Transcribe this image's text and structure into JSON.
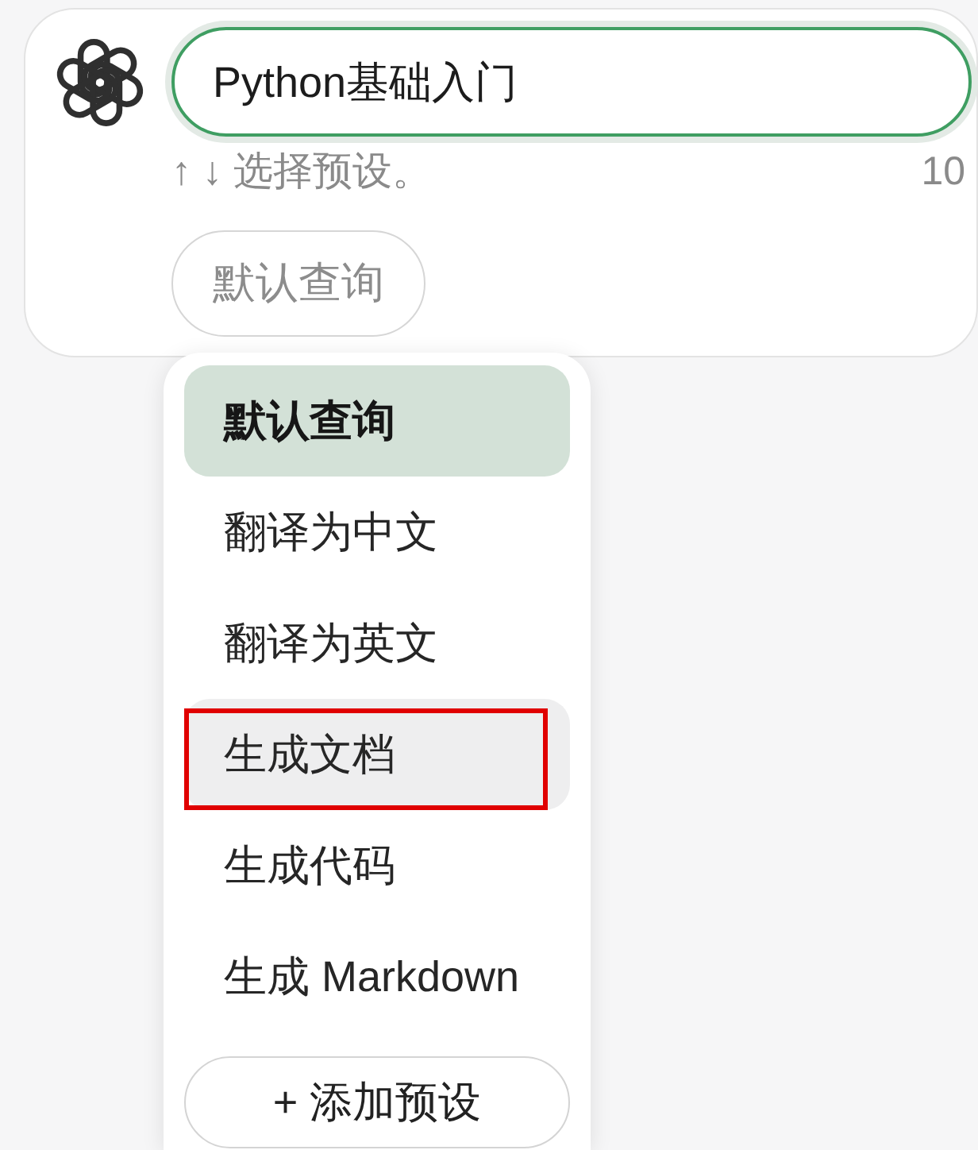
{
  "composer": {
    "input": {
      "value": "Python基础入门",
      "focused": true
    },
    "hint": "↑ ↓ 选择预设。",
    "count": "10",
    "preset_button": "默认查询"
  },
  "preset_menu": {
    "items": [
      {
        "label": "默认查询",
        "selected": true,
        "hovered": false,
        "marked": false
      },
      {
        "label": "翻译为中文",
        "selected": false,
        "hovered": false,
        "marked": false
      },
      {
        "label": "翻译为英文",
        "selected": false,
        "hovered": false,
        "marked": false
      },
      {
        "label": "生成文档",
        "selected": false,
        "hovered": true,
        "marked": true
      },
      {
        "label": "生成代码",
        "selected": false,
        "hovered": false,
        "marked": false
      },
      {
        "label": "生成 Markdown",
        "selected": false,
        "hovered": false,
        "marked": false
      }
    ],
    "add_button": "+ 添加预设"
  }
}
